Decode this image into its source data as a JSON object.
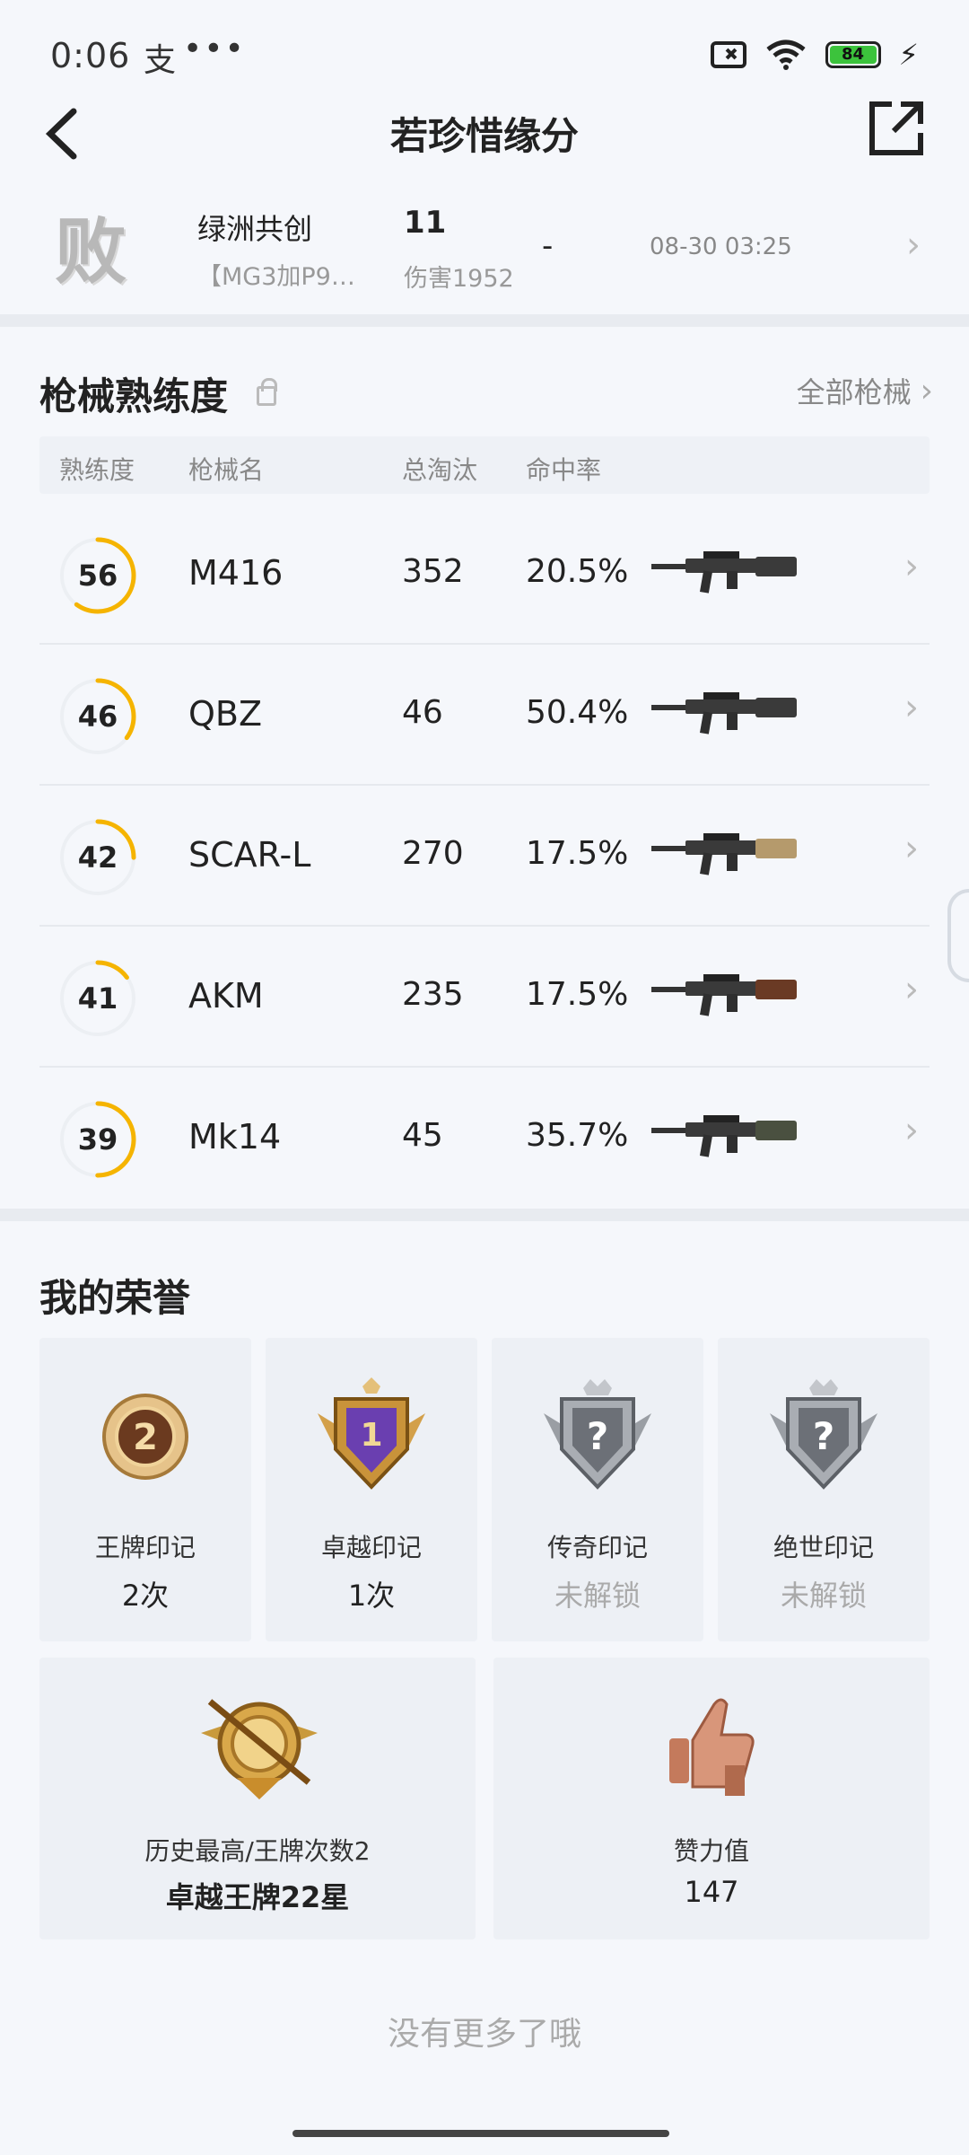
{
  "status_bar": {
    "time": "0:06",
    "app_icon": "支",
    "more": "•••",
    "battery": "84"
  },
  "header": {
    "title": "若珍惜缘分"
  },
  "match": {
    "result": "败",
    "mode": "绿洲共创",
    "sub": "【MG3加P9…",
    "kills": "11",
    "damage": "伤害1952",
    "rank": "-",
    "time": "08-30 03:25"
  },
  "weapons_section": {
    "title": "枪械熟练度",
    "all_link": "全部枪械",
    "columns": [
      "熟练度",
      "枪械名",
      "总淘汰",
      "命中率"
    ],
    "rows": [
      {
        "level": "56",
        "progress": 0.6,
        "name": "M416",
        "kills": "352",
        "rate": "20.5%",
        "stock_color": "#3a3a3a"
      },
      {
        "level": "46",
        "progress": 0.35,
        "name": "QBZ",
        "kills": "46",
        "rate": "50.4%",
        "stock_color": "#3a3a3a"
      },
      {
        "level": "42",
        "progress": 0.25,
        "name": "SCAR-L",
        "kills": "270",
        "rate": "17.5%",
        "stock_color": "#b59a6c"
      },
      {
        "level": "41",
        "progress": 0.15,
        "name": "AKM",
        "kills": "235",
        "rate": "17.5%",
        "stock_color": "#6a3a24"
      },
      {
        "level": "39",
        "progress": 0.5,
        "name": "Mk14",
        "kills": "45",
        "rate": "35.7%",
        "stock_color": "#4a5040"
      }
    ]
  },
  "honors_section": {
    "title": "我的荣誉",
    "marks": [
      {
        "icon": "ace-mark-medal-icon",
        "label": "王牌印记",
        "value": "2次",
        "badge": "2"
      },
      {
        "icon": "excellence-mark-medal-icon",
        "label": "卓越印记",
        "value": "1次",
        "badge": "1"
      },
      {
        "icon": "legend-mark-locked-icon",
        "label": "传奇印记",
        "value": "未解锁",
        "badge": "?"
      },
      {
        "icon": "peerless-mark-locked-icon",
        "label": "绝世印记",
        "value": "未解锁",
        "badge": "?"
      }
    ],
    "history": {
      "label": "历史最高/王牌次数2",
      "value": "卓越王牌22星"
    },
    "likes": {
      "label": "赞力值",
      "value": "147"
    }
  },
  "footer": {
    "no_more": "没有更多了哦"
  },
  "colors": {
    "accent_ring": "#f5b400",
    "ring_track": "#eceff3"
  }
}
